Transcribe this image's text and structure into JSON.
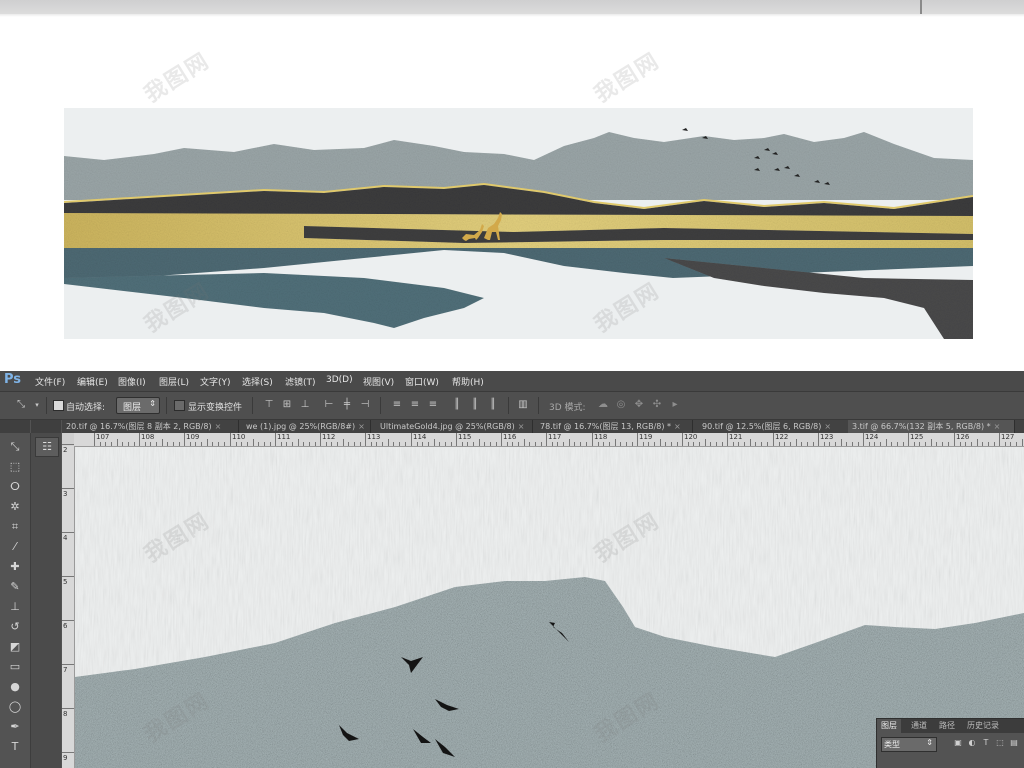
{
  "app": {
    "logo": "Ps",
    "menus": [
      "文件(F)",
      "编辑(E)",
      "图像(I)",
      "图层(L)",
      "文字(Y)",
      "选择(S)",
      "滤镜(T)",
      "3D(D)",
      "视图(V)",
      "窗口(W)",
      "帮助(H)"
    ]
  },
  "options": {
    "auto_select_label": "自动选择:",
    "auto_select_value": "图层",
    "show_transform_label": "显示变换控件",
    "mode_3d_label": "3D 模式:"
  },
  "tabs": [
    "20.tif @ 16.7%(图层 8 副本 2, RGB/8)",
    "we (1).jpg @ 25%(RGB/8#)",
    "UltimateGold4.jpg @ 25%(RGB/8)",
    "78.tif @ 16.7%(图层 13, RGB/8) *",
    "90.tif @ 12.5%(图层 6, RGB/8)",
    "3.tif @ 66.7%(132 副本 5, RGB/8) *"
  ],
  "ruler": {
    "h_labels": [
      "107",
      "108",
      "109",
      "110",
      "111",
      "112",
      "113",
      "114",
      "115",
      "116",
      "117",
      "118",
      "119",
      "120",
      "121",
      "122",
      "123",
      "124",
      "125",
      "126",
      "127"
    ],
    "v_labels": [
      "2",
      "3",
      "4",
      "5",
      "6",
      "7",
      "8",
      "9"
    ]
  },
  "layers_panel": {
    "tabs": [
      "图层",
      "通道",
      "路径",
      "历史记录"
    ],
    "filter_value": "类型"
  },
  "icons": {
    "move": "move-tool-icon",
    "marquee": "rect-marquee-icon",
    "lasso": "lasso-icon",
    "wand": "magic-wand-icon",
    "crop": "crop-icon",
    "eyedropper": "eyedropper-icon",
    "heal": "healing-brush-icon",
    "brush": "brush-icon",
    "stamp": "clone-stamp-icon",
    "history": "history-brush-icon",
    "eraser": "eraser-icon",
    "gradient": "gradient-icon",
    "blur": "blur-icon",
    "dodge": "dodge-icon",
    "pen": "pen-icon",
    "type": "type-icon"
  },
  "colors": {
    "ps_bg": "#535353",
    "menu_bg": "#4a4a4a",
    "gold": "#d9c369",
    "teal": "#4f6d78",
    "dark": "#3a3a3a",
    "sky": "#e8eced"
  }
}
